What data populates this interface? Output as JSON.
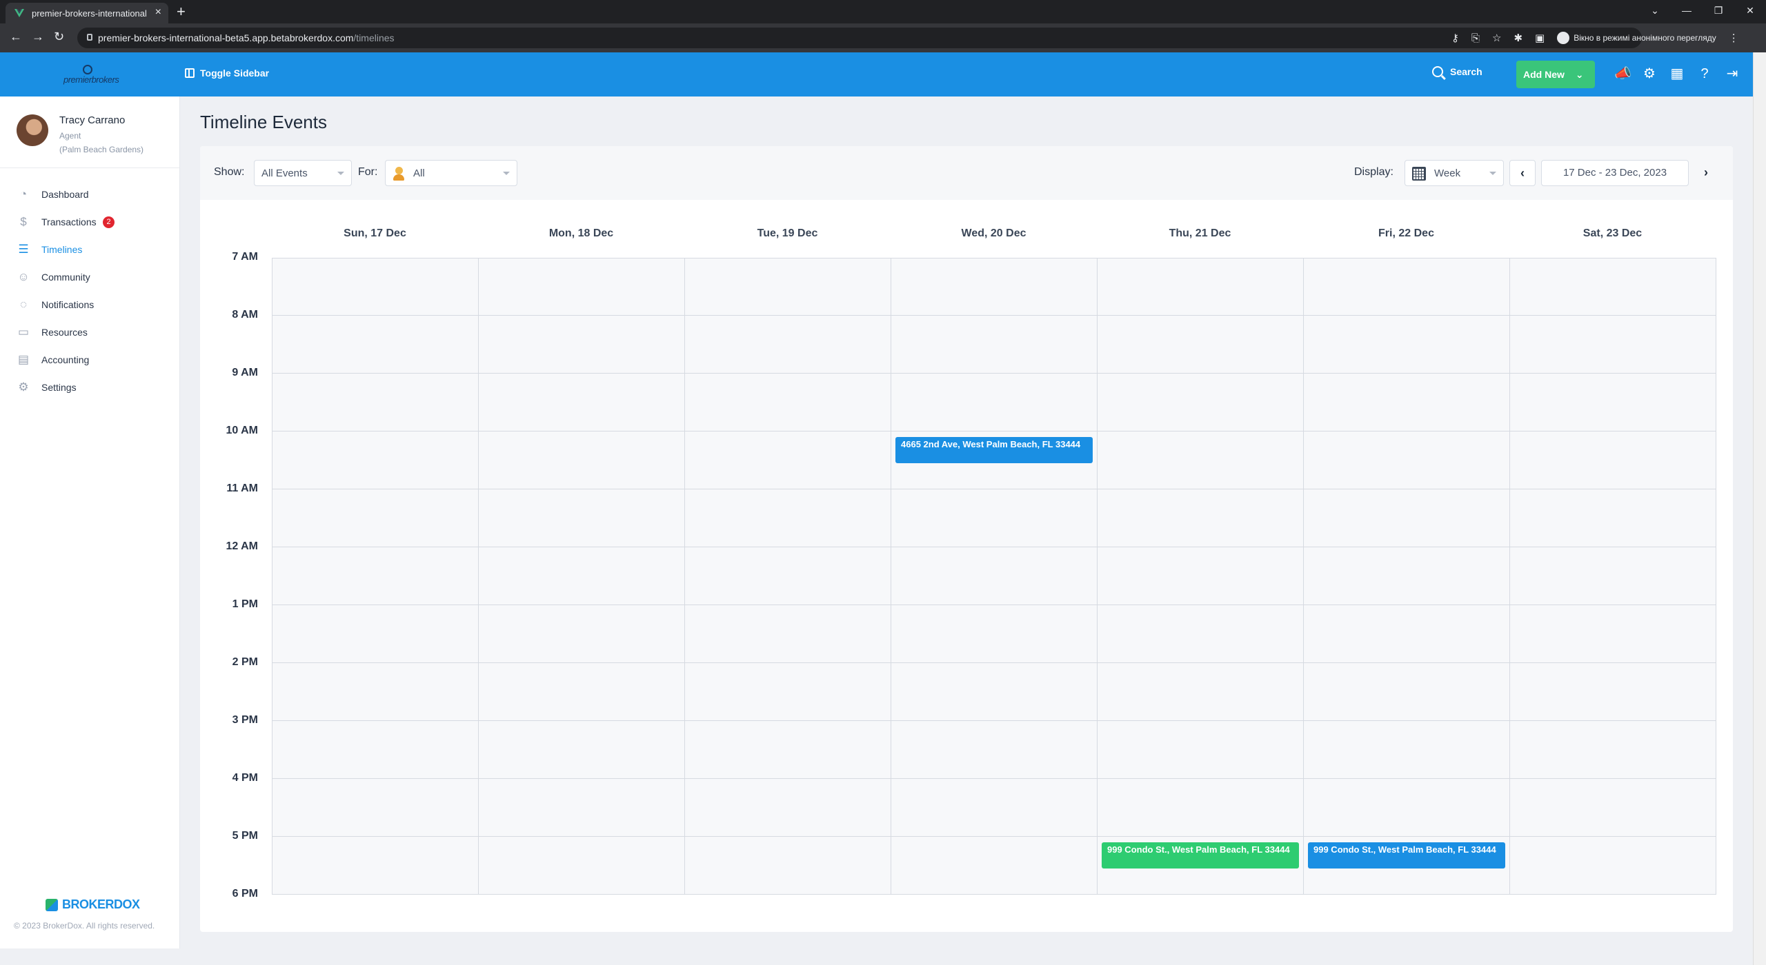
{
  "browser": {
    "tab_title": "premier-brokers-international",
    "url_host": "premier-brokers-international-beta5.app.betabrokerdox.com",
    "url_path": "/timelines",
    "incognito_label": "Вікно в режимі анонімного перегляду"
  },
  "header": {
    "logo_text": "premierbrokers",
    "toggle_sidebar": "Toggle Sidebar",
    "search": "Search",
    "add_new": "Add New",
    "icons": [
      "megaphone-icon",
      "gear-icon",
      "calculator-icon",
      "help-icon",
      "logout-icon"
    ]
  },
  "user": {
    "name": "Tracy Carrano",
    "role": "Agent",
    "office": "(Palm Beach Gardens)"
  },
  "sidebar": {
    "items": [
      {
        "label": "Dashboard",
        "icon": "dashboard-icon",
        "active": false
      },
      {
        "label": "Transactions",
        "icon": "dollar-icon",
        "badge": "2",
        "active": false
      },
      {
        "label": "Timelines",
        "icon": "timeline-icon",
        "active": true
      },
      {
        "label": "Community",
        "icon": "community-icon",
        "active": false
      },
      {
        "label": "Notifications",
        "icon": "chat-icon",
        "active": false
      },
      {
        "label": "Resources",
        "icon": "folder-icon",
        "active": false
      },
      {
        "label": "Accounting",
        "icon": "accounting-icon",
        "active": false
      },
      {
        "label": "Settings",
        "icon": "settings-icon",
        "active": false
      }
    ],
    "brand": "BROKERDOX",
    "copyright": "© 2023 BrokerDox. All rights reserved."
  },
  "page": {
    "title": "Timeline Events",
    "show_label": "Show:",
    "show_value": "All Events",
    "for_label": "For:",
    "for_value": "All",
    "display_label": "Display:",
    "display_value": "Week",
    "date_range": "17 Dec - 23 Dec, 2023"
  },
  "calendar": {
    "days": [
      "Sun, 17 Dec",
      "Mon, 18 Dec",
      "Tue, 19 Dec",
      "Wed, 20 Dec",
      "Thu, 21 Dec",
      "Fri, 22 Dec",
      "Sat, 23 Dec"
    ],
    "hours": [
      "7 AM",
      "8 AM",
      "9 AM",
      "10 AM",
      "11 AM",
      "12 AM",
      "1 PM",
      "2 PM",
      "3 PM",
      "4 PM",
      "5 PM",
      "6 PM"
    ],
    "events": [
      {
        "title": "4665 2nd Ave, West Palm Beach, FL 33444",
        "day": "Wed, 20 Dec",
        "time": "10 AM",
        "color": "#1a8fe3"
      },
      {
        "title": "999 Condo St., West Palm Beach, FL 33444",
        "day": "Thu, 21 Dec",
        "time": "5 PM",
        "color": "#2ecc71"
      },
      {
        "title": "999 Condo St., West Palm Beach, FL 33444",
        "day": "Fri, 22 Dec",
        "time": "5 PM",
        "color": "#1a8fe3"
      }
    ]
  },
  "colors": {
    "header_blue": "#1a8fe3",
    "add_new_green": "#3ac57a",
    "badge_red": "#e1252f"
  }
}
